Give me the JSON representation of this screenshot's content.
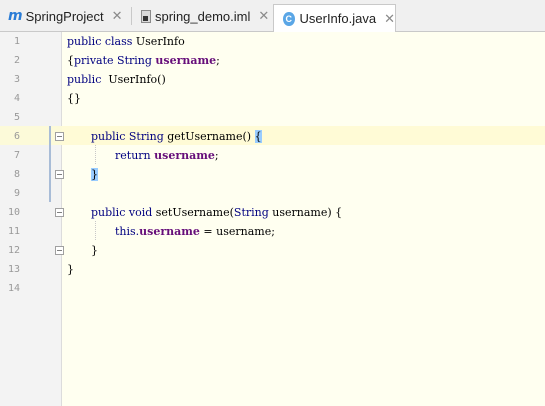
{
  "tabs": [
    {
      "icon": "m-icon",
      "label": "SpringProject",
      "active": false
    },
    {
      "icon": "file-icon",
      "label": "spring_demo.iml",
      "active": false
    },
    {
      "icon": "class-icon",
      "label": "UserInfo.java",
      "active": true
    }
  ],
  "tab_icon_glyphs": {
    "m": "m",
    "c": "C"
  },
  "close_glyph": "✕",
  "line_numbers": [
    "1",
    "2",
    "3",
    "4",
    "5",
    "6",
    "7",
    "8",
    "9",
    "10",
    "11",
    "12",
    "13",
    "14"
  ],
  "code": {
    "l1": {
      "kw1": "public class",
      "rest": " UserInfo"
    },
    "l2": {
      "pre": "{",
      "kw": "private",
      "type": " String ",
      "field": "username",
      "post": ";"
    },
    "l3": {
      "kw": "public",
      "rest": "  UserInfo()"
    },
    "l4": {
      "text": "{}"
    },
    "l6": {
      "kw": "public",
      "type": " String ",
      "method": "getUsername()",
      "sp": " ",
      "brace": "{"
    },
    "l7": {
      "kw": "return",
      "sp": " ",
      "field": "username",
      "post": ";"
    },
    "l8": {
      "brace": "}"
    },
    "l10": {
      "kw": "public void",
      "method": " setUsername(",
      "type": "String",
      "param": " username) ",
      "post": "{"
    },
    "l11": {
      "kw": "this.",
      "field": "username",
      "post": " = username;"
    },
    "l12": {
      "text": "}"
    },
    "l13": {
      "text": "}"
    }
  },
  "colors": {
    "keyword": "#000080",
    "field": "#660e7a",
    "brace_highlight": "#99ccff",
    "caret_line": "#fffbd6",
    "editor_bg": "#fffff0"
  }
}
